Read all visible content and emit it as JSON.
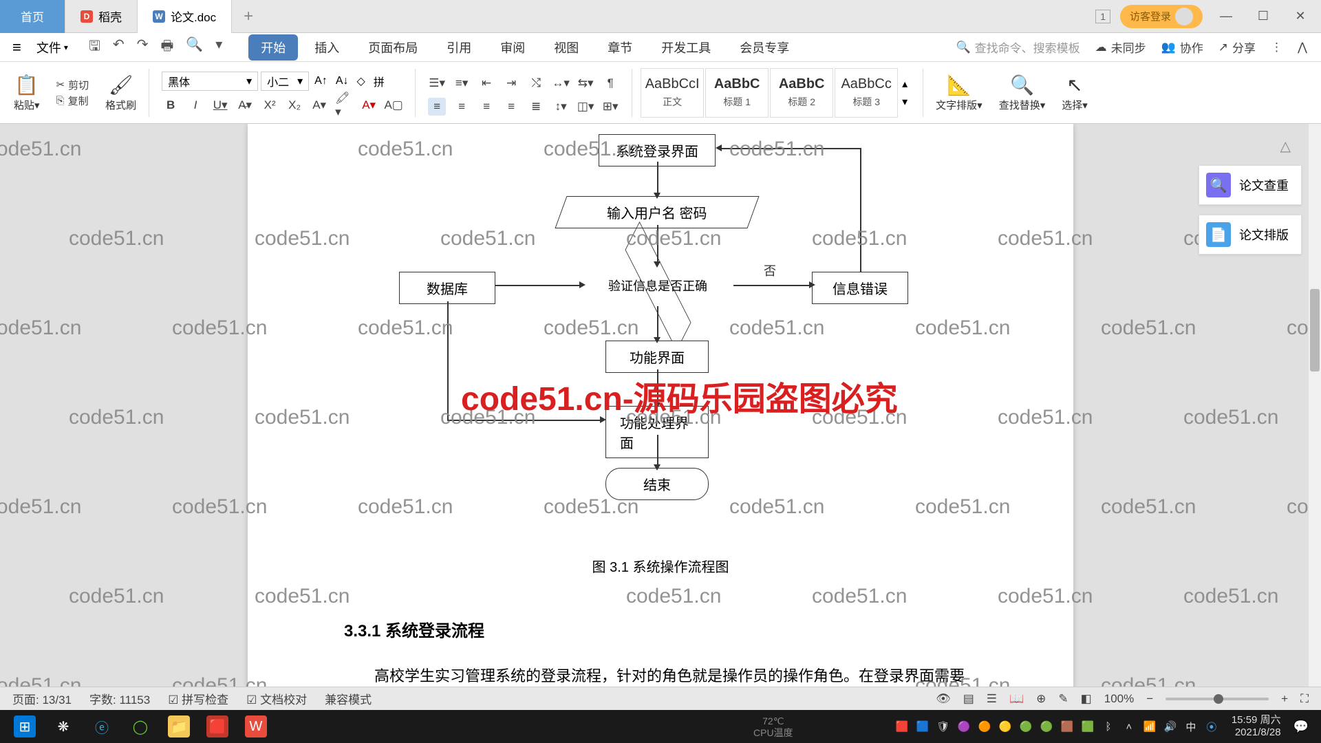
{
  "titleBar": {
    "tabs": [
      {
        "label": "首页",
        "type": "home"
      },
      {
        "label": "稻壳",
        "type": "doc",
        "iconClass": "ico-d",
        "iconText": "D"
      },
      {
        "label": "论文.doc",
        "type": "doc",
        "active": true,
        "iconClass": "ico-w",
        "iconText": "W"
      }
    ],
    "badge1": "1",
    "login": "访客登录"
  },
  "menuBar": {
    "file": "文件",
    "tabs": [
      "开始",
      "插入",
      "页面布局",
      "引用",
      "审阅",
      "视图",
      "章节",
      "开发工具",
      "会员专享"
    ],
    "activeTab": 0,
    "searchPlaceholder": "查找命令、搜索模板",
    "right": {
      "unsync": "未同步",
      "collab": "协作",
      "share": "分享"
    }
  },
  "ribbon": {
    "paste": "粘贴",
    "cut": "剪切",
    "copy": "复制",
    "formatPainter": "格式刷",
    "fontName": "黑体",
    "fontSize": "小二",
    "styles": [
      {
        "prev": "AaBbCcI",
        "label": "正文"
      },
      {
        "prev": "AaBbC",
        "label": "标题 1"
      },
      {
        "prev": "AaBbC",
        "label": "标题 2"
      },
      {
        "prev": "AaBbCc",
        "label": "标题 3"
      }
    ],
    "textLayout": "文字排版",
    "findReplace": "查找替换",
    "select": "选择"
  },
  "flowchart": {
    "login": "系统登录界面",
    "input": "输入用户名 密码",
    "db": "数据库",
    "verify": "验证信息是否正确",
    "error": "信息错误",
    "no": "否",
    "func": "功能界面",
    "process": "功能处理界面",
    "end": "结束",
    "caption": "图 3.1  系统操作流程图"
  },
  "bigWatermark": "code51.cn-源码乐园盗图必究",
  "watermarkText": "code51.cn",
  "document": {
    "heading": "3.3.1 系统登录流程",
    "body": "高校学生实习管理系统的登录流程，针对的角色就是操作员的操作角色。在登录界面需要的必填信息就是账号信息，配上登录的密码信息就能登录高校学生"
  },
  "sidePanel": {
    "items": [
      {
        "label": "论文查重",
        "color": "#7a6ff0"
      },
      {
        "label": "论文排版",
        "color": "#4aa3e8"
      }
    ]
  },
  "statusBar": {
    "page": "页面: 13/31",
    "words": "字数: 11153",
    "spell": "拼写检查",
    "proof": "文档校对",
    "compat": "兼容模式",
    "zoom": "100%"
  },
  "taskbar": {
    "tempLabel": "CPU温度",
    "tempValue": "72℃",
    "ime": "中",
    "time": "15:59",
    "day": "周六",
    "date": "2021/8/28"
  }
}
